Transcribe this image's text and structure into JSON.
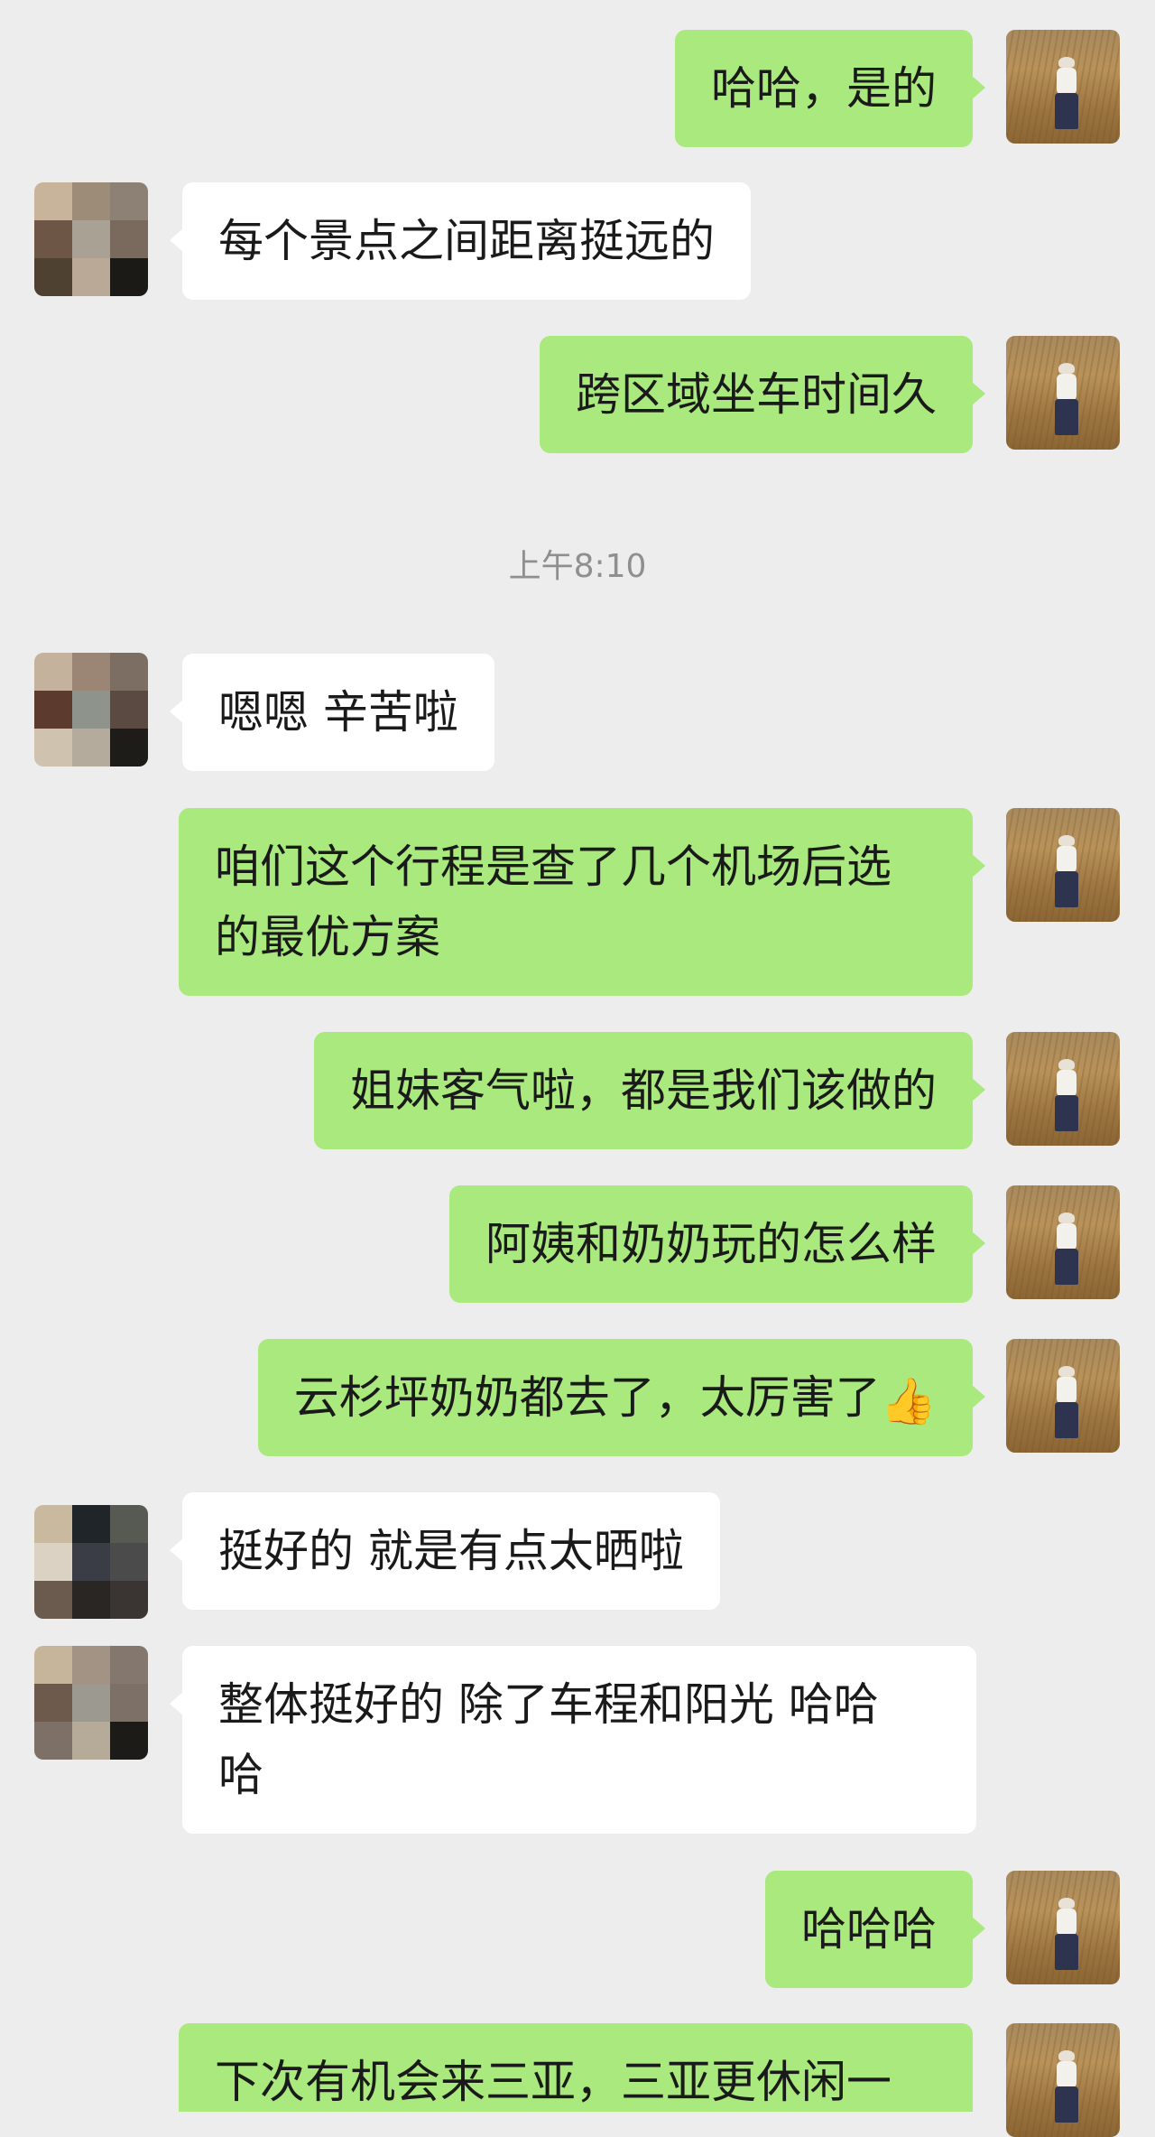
{
  "messages": [
    {
      "side": "me",
      "text": "哈哈，是的"
    },
    {
      "side": "them",
      "text": "每个景点之间距离挺远的"
    },
    {
      "side": "me",
      "text": "跨区域坐车时间久"
    },
    {
      "side": "time",
      "text": "上午8:10"
    },
    {
      "side": "them",
      "text": "嗯嗯 辛苦啦"
    },
    {
      "side": "me",
      "text": "咱们这个行程是查了几个机场后选\n的最优方案"
    },
    {
      "side": "me",
      "text": "姐妹客气啦，都是我们该做的"
    },
    {
      "side": "me",
      "text": "阿姨和奶奶玩的怎么样"
    },
    {
      "side": "me",
      "text": "云杉坪奶奶都去了，太厉害了",
      "emoji": "👍"
    },
    {
      "side": "them",
      "text": "挺好的 就是有点太晒啦"
    },
    {
      "side": "them",
      "text": "整体挺好的 除了车程和阳光 哈哈\n哈"
    },
    {
      "side": "me",
      "text": "哈哈哈"
    },
    {
      "side": "me",
      "text": "下次有机会来三亚，三亚更休闲一"
    }
  ],
  "colors": {
    "background": "#ededed",
    "my_bubble": "#a9e97d",
    "their_bubble": "#ffffff"
  },
  "icons": {
    "my_avatar": "avatar-wheat-field-photo",
    "their_avatar": "avatar-pixelated-mosaic"
  }
}
